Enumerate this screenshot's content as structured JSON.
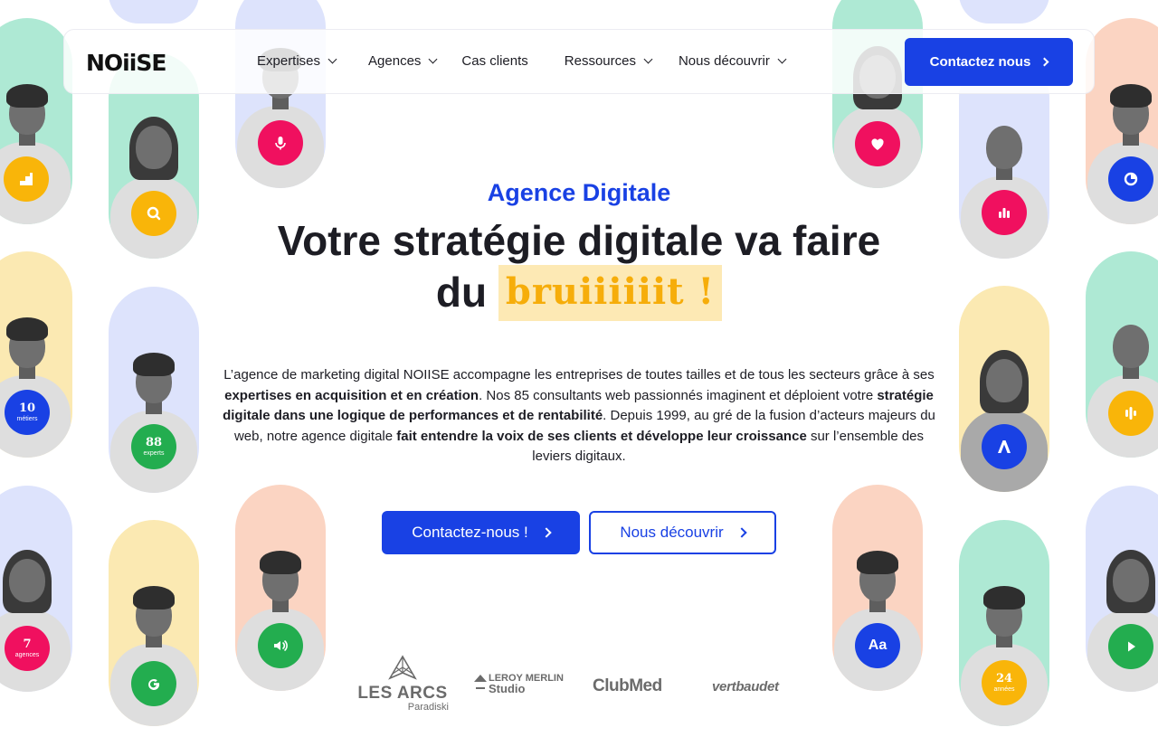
{
  "header": {
    "logo": "NOiiSE",
    "nav": [
      {
        "label": "Expertises",
        "has_dropdown": true
      },
      {
        "label": "Agences",
        "has_dropdown": true
      },
      {
        "label": "Cas clients",
        "has_dropdown": false
      },
      {
        "label": "Ressources",
        "has_dropdown": true
      },
      {
        "label": "Nous découvrir",
        "has_dropdown": true
      }
    ],
    "contact_label": "Contactez nous"
  },
  "hero": {
    "eyebrow": "Agence Digitale",
    "headline_line1": "Votre stratégie digitale va faire",
    "headline_line2_prefix": "du",
    "headline_highlight": "bruiiiiiit !",
    "intro": {
      "p1": "L’agence de marketing digital NOIISE accompagne les entreprises de toutes tailles et de tous les secteurs grâce à ses ",
      "b1": "expertises en acquisition et en création",
      "p2": ". Nos 85 consultants web passionnés imaginent et déploient votre ",
      "b2": "stratégie digitale dans une logique de performances et de rentabilité",
      "p3": ". Depuis 1999, au gré de la fusion d’acteurs majeurs du web, notre agence digitale ",
      "b3": "fait entendre la voix de ses clients et développe leur croissance",
      "p4": " sur l’ensemble des leviers digitaux."
    },
    "cta_primary": "Contactez-nous !",
    "cta_secondary": "Nous découvrir"
  },
  "badges": {
    "metiers": {
      "number": "10",
      "label": "métiers"
    },
    "experts": {
      "number": "88",
      "label": "experts"
    },
    "agences": {
      "number": "7",
      "label": "agences"
    },
    "annees": {
      "number": "24",
      "label": "années"
    },
    "typography": "Aa"
  },
  "clients": {
    "les_arcs": {
      "name": "LES ARCS",
      "sub": "Paradiski"
    },
    "leroy": {
      "name": "LEROY MERLIN",
      "sub": "Studio"
    },
    "clubmed": "ClubMed",
    "vertbaudet": "vertbaudet"
  },
  "colors": {
    "brand_blue": "#1941e4",
    "highlight_yellow": "#f6ad0a",
    "highlight_bg": "#fde9b4",
    "pink": "#f0105f",
    "green": "#23ad4f",
    "yellow": "#f9b509"
  },
  "icons": [
    "bar-chart-icon",
    "microphone-icon",
    "search-icon",
    "heart-icon",
    "pie-chart-icon",
    "stats-icon",
    "logo-a-icon",
    "equalizer-icon",
    "volume-icon",
    "google-icon",
    "play-icon"
  ]
}
